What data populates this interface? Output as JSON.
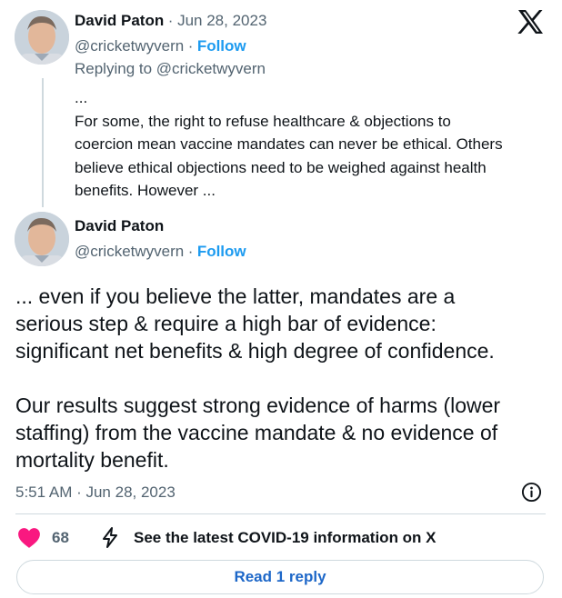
{
  "quoted_tweet": {
    "author_name": "David Paton",
    "date": "· Jun 28, 2023",
    "handle": "@cricketwyvern",
    "separator": "·",
    "follow_label": "Follow",
    "replying_to": "Replying to @cricketwyvern",
    "text": "...\nFor some, the right to refuse healthcare & objections to\ncoercion mean vaccine mandates can never be ethical.  Others\nbelieve ethical objections need to be weighed against health\nbenefits. However ..."
  },
  "main_tweet": {
    "author_name": "David Paton",
    "handle": "@cricketwyvern",
    "separator": "·",
    "follow_label": "Follow",
    "text": "... even if you believe the latter, mandates are a\nserious step & require a high bar of evidence:\nsignificant net benefits & high degree of confidence.\n\nOur results suggest strong evidence of harms (lower\nstaffing) from the vaccine mandate & no evidence of\nmortality benefit.",
    "timestamp": "5:51 AM · Jun 28, 2023"
  },
  "actions": {
    "likes_count": "68",
    "covid_info_label": "See the latest COVID-19 information on X",
    "read_reply_label": "Read 1 reply"
  },
  "icons": {
    "logo": "x-logo-icon",
    "info": "info-icon",
    "heart": "heart-icon",
    "flash": "lightning-icon"
  },
  "colors": {
    "text": "#0f1419",
    "muted": "#536471",
    "accent": "#1d9bf0",
    "heart": "#f91880",
    "border": "#cfd9de"
  }
}
